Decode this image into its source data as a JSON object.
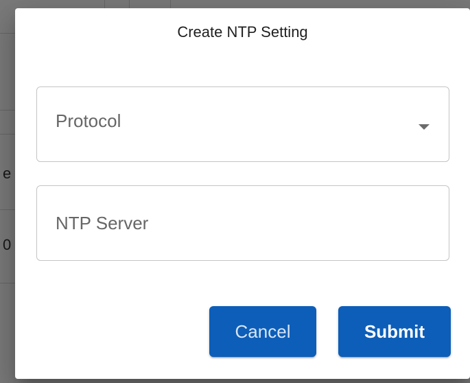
{
  "dialog": {
    "title": "Create NTP Setting",
    "protocol_field": {
      "label": "Protocol",
      "icon": "chevron-down-icon"
    },
    "ntp_server_field": {
      "placeholder": "NTP Server",
      "value": ""
    },
    "buttons": {
      "cancel_label": "Cancel",
      "submit_label": "Submit"
    }
  },
  "background": {
    "fragments": [
      "e",
      "0"
    ]
  },
  "colors": {
    "primary": "#0d5eb8",
    "overlay": "rgba(0,0,0,0.5)",
    "label_gray": "#666666"
  }
}
